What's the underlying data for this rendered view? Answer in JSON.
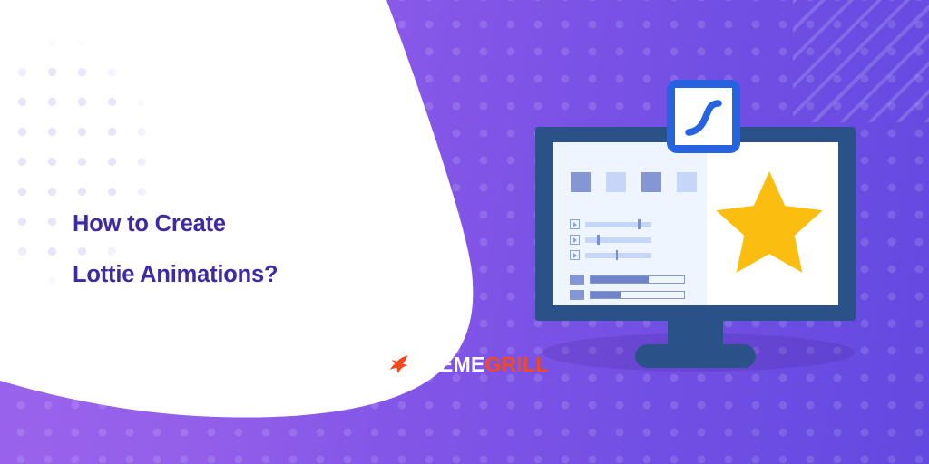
{
  "banner": {
    "headline_line1": "How to Create",
    "headline_line2": "Lottie Animations?",
    "headline_color": "#3d2ba3",
    "background_gradient_from": "#9b63ec",
    "background_gradient_to": "#6449e0"
  },
  "logo": {
    "icon": "flame-icon",
    "word_primary": "THEME",
    "word_secondary": "GRILL",
    "primary_color": "#ffffff",
    "secondary_color": "#f4491f"
  },
  "illustration": {
    "name": "desktop-monitor-illustration",
    "bezel_color": "#2a5288",
    "screen_color": "#eff5fe",
    "badge": {
      "icon": "ease-curve-icon",
      "frame_color": "#2563e0",
      "fill_color": "#ffffff"
    },
    "star": {
      "icon": "star-icon",
      "color": "#fbbd10"
    },
    "swatches": [
      {
        "tone": "dark"
      },
      {
        "tone": "light"
      },
      {
        "tone": "dark"
      },
      {
        "tone": "light"
      }
    ],
    "sliders": [
      {
        "icon": "play-icon",
        "value": 80
      },
      {
        "icon": "play-icon",
        "value": 18
      },
      {
        "icon": "play-icon",
        "value": 46
      }
    ],
    "progress_bars": [
      {
        "value": 62
      },
      {
        "value": 32
      }
    ]
  },
  "decoration": {
    "stripes": "diagonal-stripes",
    "dot_grid_purple": "dot-grid",
    "dot_grid_lavender": "dot-grid"
  }
}
